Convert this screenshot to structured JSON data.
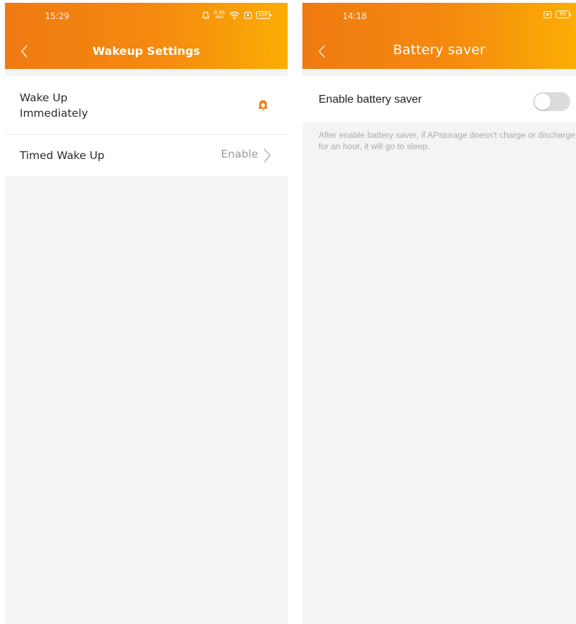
{
  "left_screen": {
    "status_bar": {
      "time": "15:29",
      "network_rate_value": "0.95",
      "network_rate_unit": "KB/S",
      "battery": "100",
      "icons": [
        "bell-icon",
        "wifi-icon",
        "sim-icon",
        "battery-icon"
      ]
    },
    "header": {
      "title": "Wakeup Settings",
      "back_icon": "chevron-left-icon"
    },
    "settings": {
      "wake_up_immediately": {
        "label": "Wake Up Immediately",
        "icon": "bell-icon",
        "icon_color": "#f07a12"
      },
      "timed_wake_up": {
        "label": "Timed Wake Up",
        "value": "Enable",
        "icon": "chevron-right-icon"
      }
    }
  },
  "right_screen": {
    "status_bar": {
      "time": "14:18",
      "battery": "95",
      "icons": [
        "sim-icon",
        "battery-icon"
      ]
    },
    "header": {
      "title": "Battery saver",
      "back_icon": "chevron-left-icon"
    },
    "battery_saver": {
      "label": "Enable battery saver",
      "enabled": false,
      "description": "After enable battery saver, if APstorage doesn't charge or discharge for an hour, it will go to sleep."
    }
  },
  "colors": {
    "header_gradient_start": "#f07a12",
    "header_gradient_end": "#fbad05",
    "page_background": "#f4f4f4",
    "toggle_off": "#dcdcdc"
  }
}
